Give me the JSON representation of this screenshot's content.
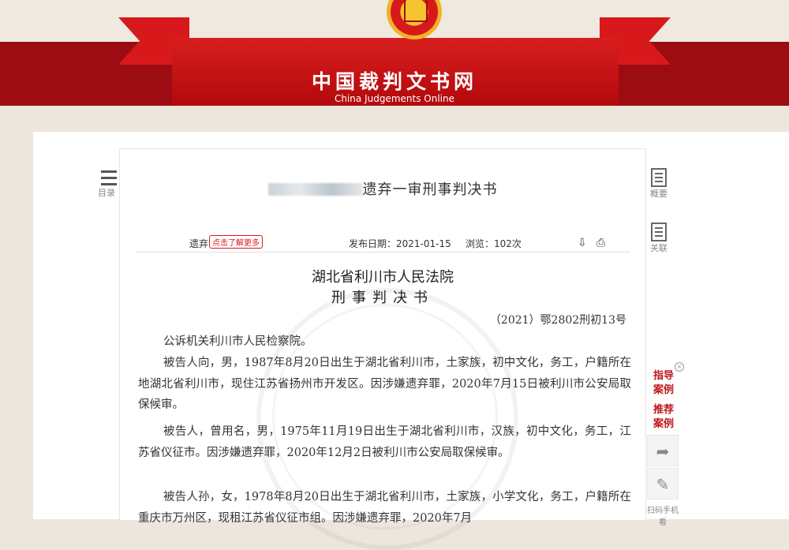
{
  "header": {
    "site_title": "中国裁判文书网",
    "site_subtitle": "China Judgements Online"
  },
  "left_nav": {
    "toc_label": "目录"
  },
  "right_nav": {
    "summary_label": "概要",
    "related_label": "关联"
  },
  "document": {
    "title_suffix": "遗弃一审刑事判决书",
    "keyword_tag": "遗弃",
    "more_button": "点击了解更多",
    "publish_date": "发布日期：2021-01-15",
    "views": "浏览：102次",
    "court_name": "湖北省利川市人民法院",
    "doc_type": "刑事判决书",
    "case_number": "（2021）鄂2802刑初13号",
    "paragraphs": [
      "公诉机关利川市人民检察院。",
      "被告人向，男，1987年8月20日出生于湖北省利川市，土家族，初中文化，务工，户籍所在地湖北省利川市，现住江苏省扬州市开发区。因涉嫌遗弃罪，2020年7月15日被利川市公安局取保候审。",
      "被告人，曾用名，男，1975年11月19日出生于湖北省利川市，汉族，初中文化，务工，江苏省仪征市。因涉嫌遗弃罪，2020年12月2日被利川市公安局取保候审。",
      "被告人孙，女，1978年8月20日出生于湖北省利川市，土家族，小学文化，务工，户籍所在重庆市万州区，现租江苏省仪征市组。因涉嫌遗弃罪，2020年7月"
    ]
  },
  "floating": {
    "guide_case": "指导案例",
    "recommend_case": "推荐案例",
    "close": "×",
    "scan_label": "扫码手机看"
  }
}
